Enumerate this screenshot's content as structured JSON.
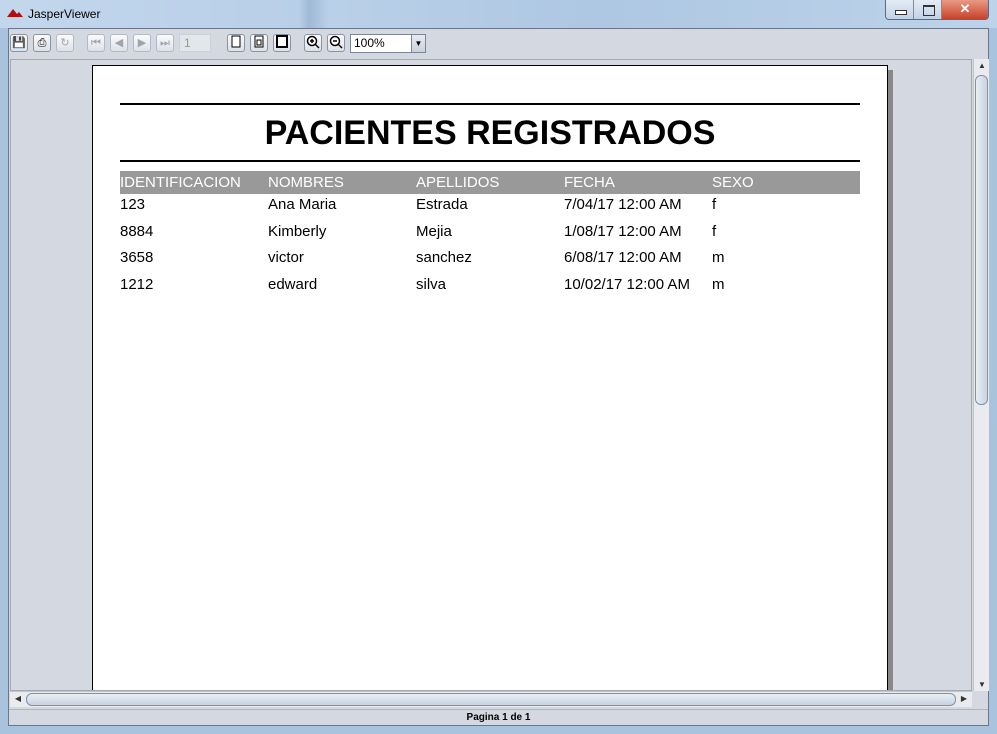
{
  "window": {
    "title": "JasperViewer",
    "close_glyph": "✕"
  },
  "toolbar": {
    "buttons": [
      {
        "name": "save",
        "glyph": "💾"
      },
      {
        "name": "print",
        "glyph": "⎙"
      },
      {
        "name": "reload",
        "glyph": "↻"
      },
      {
        "name": "first-page",
        "glyph": "⏮"
      },
      {
        "name": "previous-page",
        "glyph": "◀"
      },
      {
        "name": "next-page",
        "glyph": "▶"
      },
      {
        "name": "last-page",
        "glyph": "⏭"
      }
    ],
    "page_number": "1",
    "zoom_value": "100%"
  },
  "report": {
    "title": "PACIENTES REGISTRADOS",
    "columns": [
      "IDENTIFICACION",
      "NOMBRES",
      "APELLIDOS",
      "FECHA",
      "SEXO"
    ],
    "rows": [
      [
        "123",
        "Ana Maria",
        "Estrada",
        "7/04/17 12:00 AM",
        "f"
      ],
      [
        "8884",
        "Kimberly",
        "Mejia",
        "1/08/17 12:00 AM",
        "f"
      ],
      [
        "3658",
        "victor",
        "sanchez",
        "6/08/17 12:00 AM",
        "m"
      ],
      [
        "1212",
        "edward",
        "silva",
        "10/02/17 12:00 AM",
        "m"
      ]
    ]
  },
  "status": {
    "text": "Pagina 1 de 1"
  }
}
